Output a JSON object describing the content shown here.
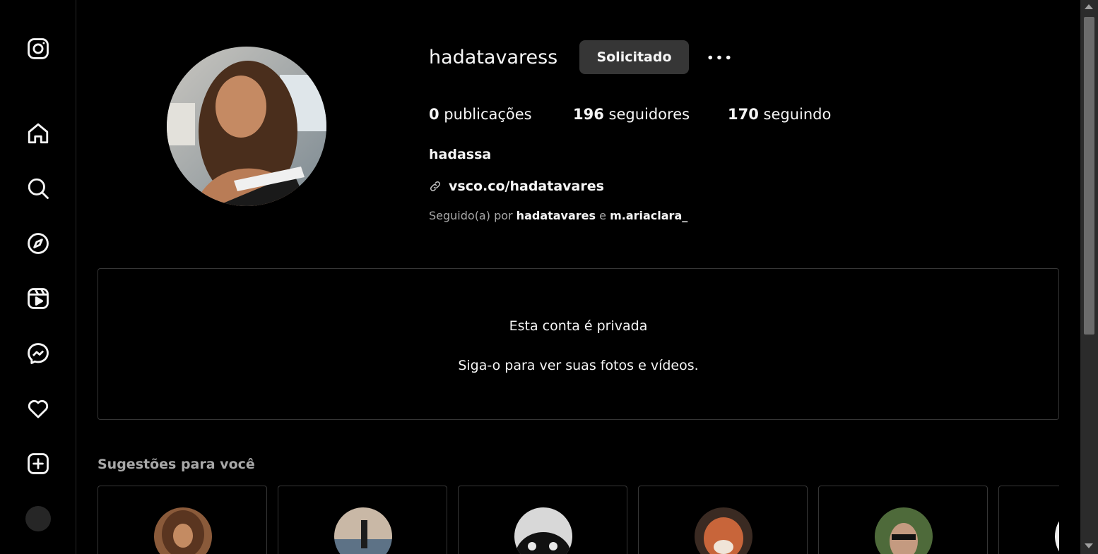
{
  "sidebar": {
    "items": [
      {
        "icon": "instagram-logo-icon"
      },
      {
        "icon": "home-icon"
      },
      {
        "icon": "search-icon"
      },
      {
        "icon": "explore-compass-icon"
      },
      {
        "icon": "reels-icon"
      },
      {
        "icon": "messenger-icon"
      },
      {
        "icon": "heart-notifications-icon"
      },
      {
        "icon": "create-plus-icon"
      },
      {
        "icon": "profile-avatar"
      }
    ]
  },
  "profile": {
    "username": "hadatavaress",
    "request_button": "Solicitado",
    "stats": {
      "posts_count": "0",
      "posts_label": " publicações",
      "followers_count": "196",
      "followers_label": " seguidores",
      "following_count": "170",
      "following_label": " seguindo"
    },
    "full_name": "hadassa",
    "link": "vsco.co/hadatavares",
    "followed_by": {
      "prefix": "Seguido(a) por ",
      "account1": "hadatavares",
      "joiner": " e ",
      "account2": "m.ariaclara_"
    }
  },
  "private_notice": {
    "title": "Esta conta é privada",
    "subtitle": "Siga-o para ver suas fotos e vídeos."
  },
  "suggestions": {
    "title": "Sugestões para você",
    "cards_visible": 6
  },
  "colors": {
    "background": "#000000",
    "text": "#f5f5f5",
    "muted": "#a8a8a8",
    "button": "#363636",
    "border": "#363636"
  }
}
